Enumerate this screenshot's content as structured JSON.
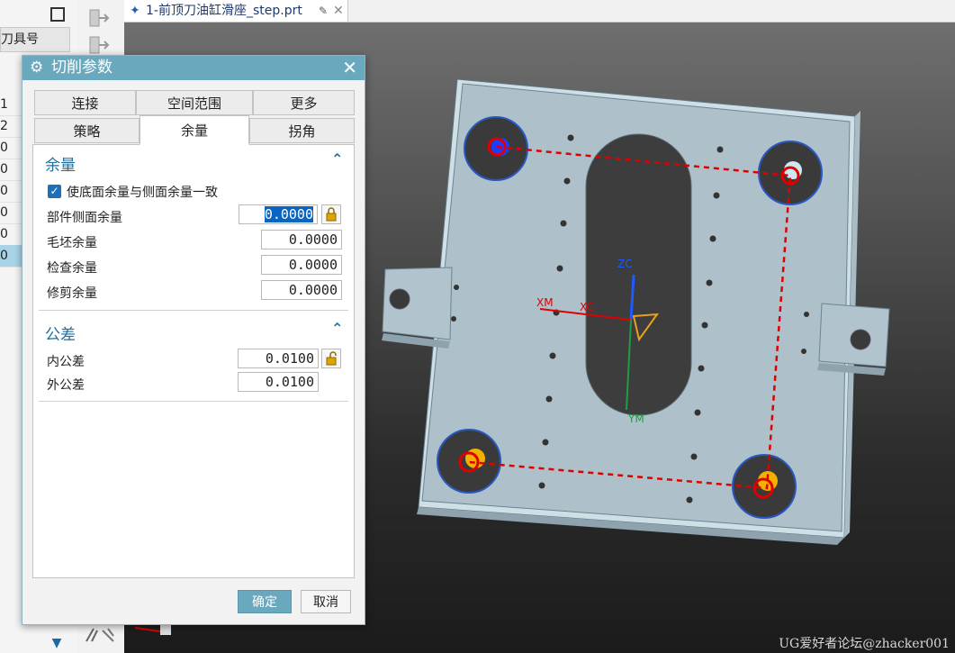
{
  "document_tab": {
    "title": "1-前顶刀油缸滑座_step.prt"
  },
  "left_panel": {
    "header": "刀具号",
    "rows": [
      "1",
      "2",
      "0",
      "0",
      "0",
      "0",
      "0",
      "0"
    ]
  },
  "dialog": {
    "title": "切削参数",
    "tabs_row1": [
      "连接",
      "空间范围",
      "更多"
    ],
    "tabs_row2": [
      "策略",
      "余量",
      "拐角"
    ],
    "allowance": {
      "section_title": "余量",
      "checkbox_label": "使底面余量与侧面余量一致",
      "checked": true,
      "fields": [
        {
          "label": "部件侧面余量",
          "value": "0.0000"
        },
        {
          "label": "毛坯余量",
          "value": "0.0000"
        },
        {
          "label": "检查余量",
          "value": "0.0000"
        },
        {
          "label": "修剪余量",
          "value": "0.0000"
        }
      ]
    },
    "tolerance": {
      "section_title": "公差",
      "fields": [
        {
          "label": "内公差",
          "value": "0.0100"
        },
        {
          "label": "外公差",
          "value": "0.0100"
        }
      ]
    },
    "ok_label": "确定",
    "cancel_label": "取消"
  },
  "viewport": {
    "axis_labels": {
      "zc": "ZC",
      "xm": "XM",
      "xc": "XC",
      "ym": "YM"
    },
    "watermark": "UG爱好者论坛@zhacker001"
  },
  "colors": {
    "accent": "#6aa8bd",
    "path": "#e00000"
  }
}
